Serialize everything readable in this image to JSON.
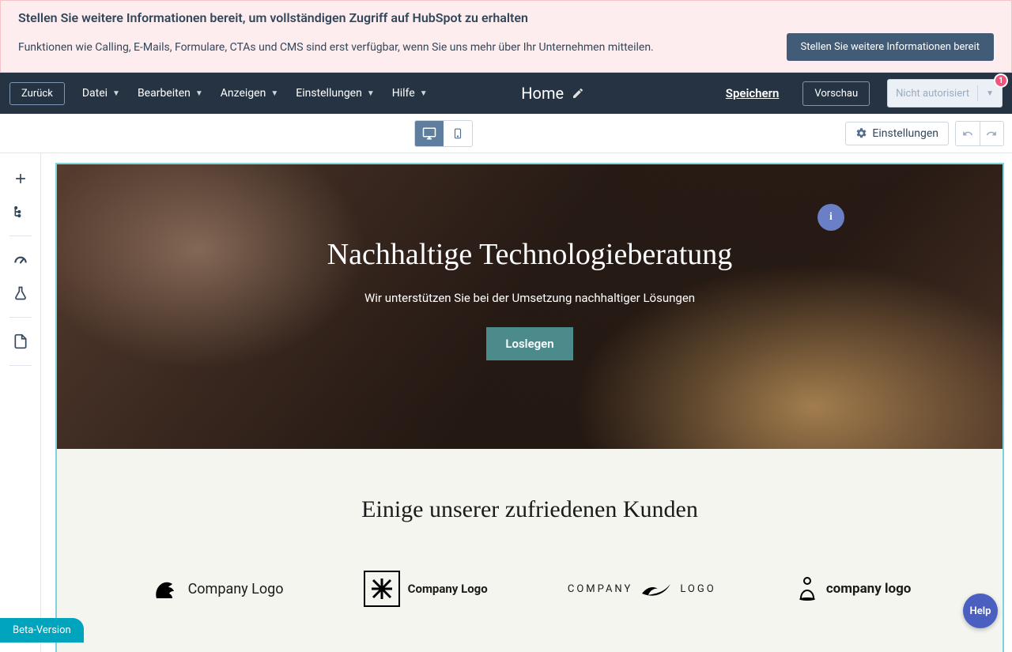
{
  "banner": {
    "title": "Stellen Sie weitere Informationen bereit, um vollständigen Zugriff auf HubSpot zu erhalten",
    "text": "Funktionen wie Calling, E-Mails, Formulare, CTAs und CMS sind erst verfügbar, wenn Sie uns mehr über Ihr Unternehmen mitteilen.",
    "button": "Stellen Sie weitere Informationen bereit"
  },
  "topbar": {
    "back": "Zurück",
    "menu": [
      "Datei",
      "Bearbeiten",
      "Anzeigen",
      "Einstellungen",
      "Hilfe"
    ],
    "page_title": "Home",
    "save": "Speichern",
    "preview": "Vorschau",
    "auth": "Nicht autorisiert",
    "badge": "1"
  },
  "subbar": {
    "settings": "Einstellungen"
  },
  "hero": {
    "title": "Nachhaltige Technologieberatung",
    "subtitle": "Wir unterstützen Sie bei der Umsetzung nachhaltiger Lösungen",
    "cta": "Loslegen",
    "info": "i"
  },
  "customers": {
    "title": "Einige unserer zufriedenen Kunden",
    "logos": [
      "Company Logo",
      "Company Logo",
      "COMPANY",
      "LOGO",
      "company logo"
    ]
  },
  "bottom": {
    "beta": "Beta-Version",
    "help": "Help"
  }
}
